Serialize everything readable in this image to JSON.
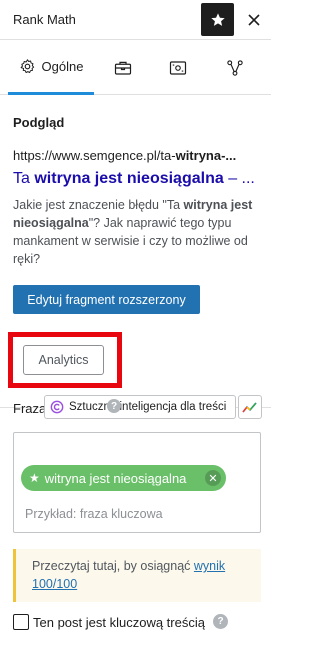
{
  "header": {
    "title": "Rank Math",
    "star_icon": "star-icon",
    "close_icon": "close-icon"
  },
  "tabs": [
    {
      "label": "Ogólne",
      "icon": "gear-icon",
      "active": true
    },
    {
      "label": "",
      "icon": "toolbox-icon",
      "active": false
    },
    {
      "label": "",
      "icon": "social-icon",
      "active": false
    },
    {
      "label": "",
      "icon": "schema-icon",
      "active": false
    }
  ],
  "preview": {
    "heading": "Podgląd",
    "url_prefix": "https://www.semgence.pl/ta-",
    "url_bold": "witryna-...",
    "title_prefix": "Ta ",
    "title_bold": "witryna jest nieosiągalna",
    "title_suffix": " – ...",
    "desc_1": "Jakie jest znaczenie błędu \"Ta ",
    "desc_bold_1": "witryna",
    "desc_2": " ",
    "desc_bold_2": "jest nieosiągalna",
    "desc_3": "\"? Jak naprawić tego typu mankament w serwisie i czy to możliwe od ręki?"
  },
  "edit_snippet_label": "Edytuj fragment rozszerzony",
  "analytics_label": "Analytics",
  "focus": {
    "label": "Fraza",
    "ai_chip_label": "Sztuczna inteligencja dla treści",
    "keyword": "witryna jest nieosiągalna",
    "input_placeholder": "Przykład: fraza kluczowa"
  },
  "notice": {
    "text": "Przeczytaj tutaj, by osiągnąć ",
    "link": "wynik 100/100"
  },
  "pillar": {
    "label": "Ten post jest kluczową treścią"
  },
  "colors": {
    "accent": "#1e8cd8",
    "button_blue": "#2271b1",
    "keyword_green": "#6abf69",
    "highlight_red": "#e8070e",
    "serp_title": "#1a0dab"
  }
}
